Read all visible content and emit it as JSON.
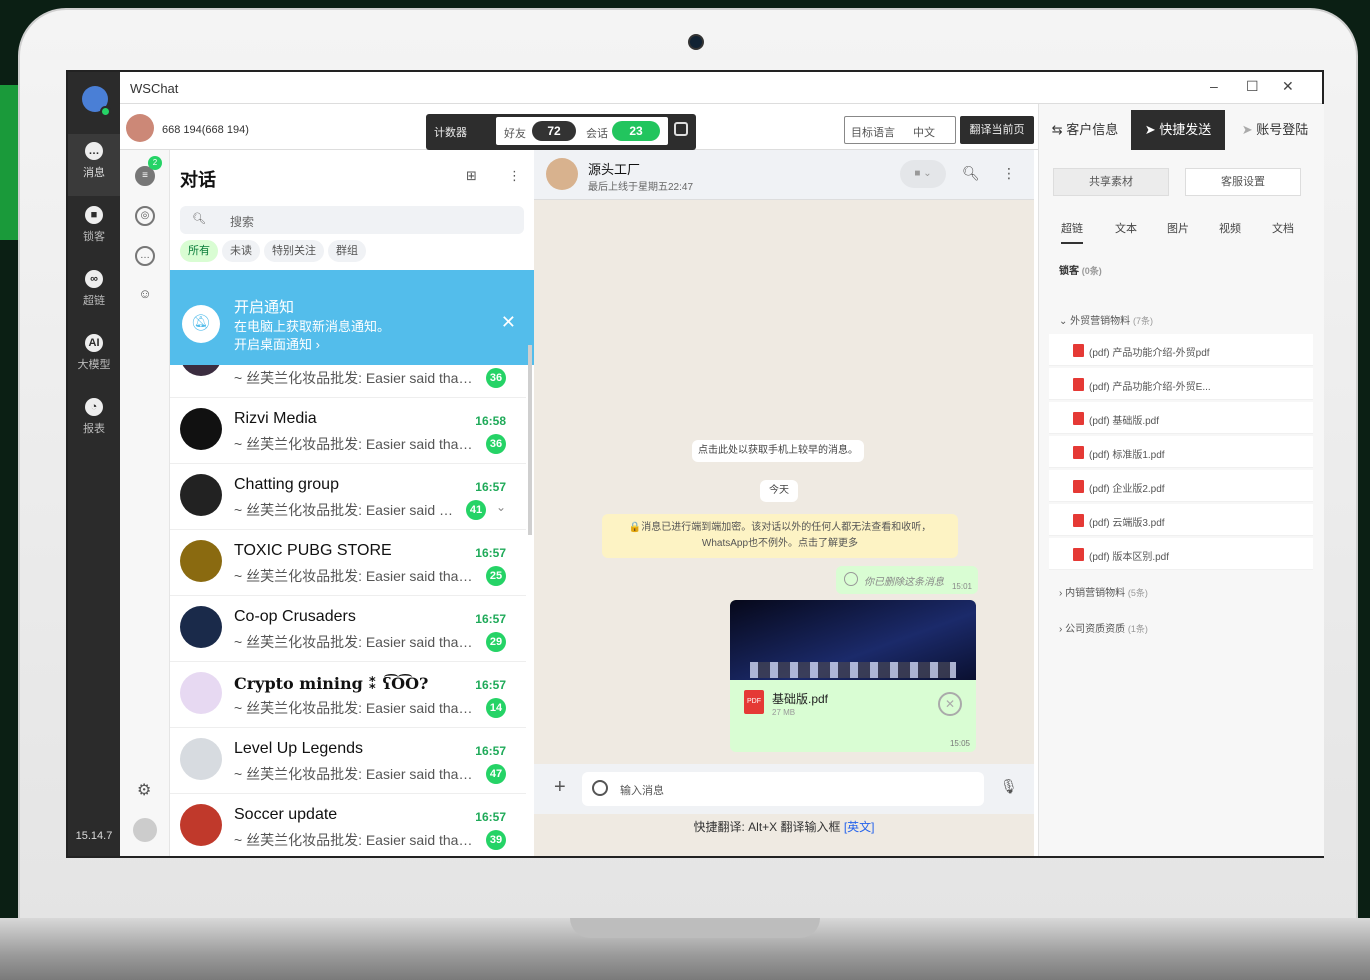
{
  "app": {
    "title": "WSChat",
    "version": "15.14.7"
  },
  "rail": {
    "items": [
      {
        "label": "消息",
        "icon": "chat-icon"
      },
      {
        "label": "锁客",
        "icon": "lock-icon"
      },
      {
        "label": "超链",
        "icon": "link-icon"
      },
      {
        "label": "大模型",
        "icon": "ai-icon"
      },
      {
        "label": "报表",
        "icon": "report-icon"
      }
    ]
  },
  "account": {
    "number": "668      194(668      194)"
  },
  "counter": {
    "label": "计数器",
    "friends_label": "好友",
    "friends": "72",
    "sessions_label": "会话",
    "sessions": "23"
  },
  "translate": {
    "target_label": "目标语言",
    "target_value": "中文",
    "translate_page": "翻译当前页"
  },
  "sidebar_tabs": [
    "客户信息",
    "快捷发送",
    "账号登陆"
  ],
  "col2": {
    "badge": "2"
  },
  "chatlist": {
    "title": "对话",
    "search_placeholder": "搜索",
    "filters": [
      "所有",
      "未读",
      "特别关注",
      "群组"
    ],
    "notification": {
      "title": "开启通知",
      "subtitle": "在电脑上获取新消息通知。",
      "action": "开启桌面通知 ›"
    },
    "rows": [
      {
        "name": "",
        "time": "",
        "preview": "~ 丝芙兰化妆品批发: Easier said than d...",
        "count": "36",
        "color": "#3b2d40"
      },
      {
        "name": "Rizvi Media",
        "time": "16:58",
        "preview": "~ 丝芙兰化妆品批发: Easier said than d...",
        "count": "36",
        "color": "#111"
      },
      {
        "name": "Chatting group",
        "time": "16:57",
        "preview": "~ 丝芙兰化妆品批发: Easier said tha...",
        "count": "41",
        "color": "#222"
      },
      {
        "name": "TOXIC PUBG STORE",
        "time": "16:57",
        "preview": "~ 丝芙兰化妆品批发: Easier said than d...",
        "count": "25",
        "color": "#8a6a10"
      },
      {
        "name": "Co-op Crusaders",
        "time": "16:57",
        "preview": "~ 丝芙兰化妆品批发: Easier said than d...",
        "count": "29",
        "color": "#1a2a4a"
      },
      {
        "name": "Crypto mining ⁑ ʕ͡O͡O?",
        "time": "16:57",
        "preview": "~ 丝芙兰化妆品批发: Easier said than d...",
        "count": "14",
        "color": "#e7d9f2"
      },
      {
        "name": "Level Up Legends",
        "time": "16:57",
        "preview": "~ 丝芙兰化妆品批发: Easier said than d...",
        "count": "47",
        "color": "#d7dbe0"
      },
      {
        "name": "Soccer update",
        "time": "16:57",
        "preview": "~ 丝芙兰化妆品批发: Easier said than d...",
        "count": "39",
        "color": "#c0392b"
      }
    ]
  },
  "conversation": {
    "name": "源头工厂",
    "status": "最后上线于星期五22:47",
    "load_old": "点击此处以获取手机上较早的消息。",
    "date": "今天",
    "encryption": "🔒消息已进行端到端加密。该对话以外的任何人都无法查看和收听，WhatsApp也不例外。点击了解更多",
    "deleted": {
      "text": "你已删除这条消息",
      "time": "15:01"
    },
    "file": {
      "name": "基础版.pdf",
      "size": "27 MB",
      "time": "15:05"
    },
    "input_placeholder": "输入消息",
    "hint_prefix": "快捷翻译: Alt+X 翻译输入框 ",
    "hint_link": "[英文]"
  },
  "quicksend": {
    "buttons": [
      "共享素材",
      "客服设置"
    ],
    "tabs": [
      "超链",
      "文本",
      "图片",
      "视频",
      "文档"
    ],
    "lock_label": "锁客",
    "lock_count": "(0条)",
    "groups": [
      {
        "name": "外贸营销物料",
        "count": "(7条)"
      },
      {
        "name": "内销营销物料",
        "count": "(5条)"
      },
      {
        "name": "公司资质资质",
        "count": "(1条)"
      }
    ],
    "files": [
      "(pdf) 产品功能介绍-外贸pdf",
      "(pdf) 产品功能介绍-外贸E...",
      "(pdf) 基础版.pdf",
      "(pdf) 标准版1.pdf",
      "(pdf) 企业版2.pdf",
      "(pdf) 云端版3.pdf",
      "(pdf) 版本区别.pdf"
    ]
  }
}
